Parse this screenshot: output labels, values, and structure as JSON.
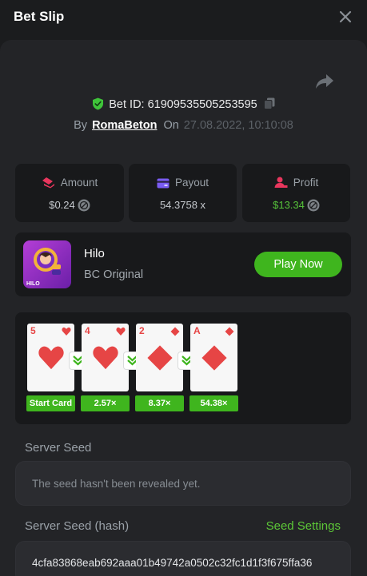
{
  "header": {
    "title": "Bet Slip"
  },
  "bet": {
    "id_text": "Bet ID: 61909535505253595",
    "by_label": "By",
    "user": "RomaBeton",
    "on_label": "On",
    "date": "27.08.2022, 10:10:08"
  },
  "stats": {
    "amount": {
      "label": "Amount",
      "value": "$0.24"
    },
    "payout": {
      "label": "Payout",
      "value": "54.3758 x"
    },
    "profit": {
      "label": "Profit",
      "value": "$13.34"
    }
  },
  "game": {
    "name": "Hilo",
    "subtitle": "BC Original",
    "play_label": "Play Now"
  },
  "cards": [
    {
      "rank": "5",
      "suit": "heart"
    },
    {
      "rank": "4",
      "suit": "heart"
    },
    {
      "rank": "2",
      "suit": "diamond"
    },
    {
      "rank": "A",
      "suit": "diamond"
    }
  ],
  "multipliers": [
    "Start Card",
    "2.57×",
    "8.37×",
    "54.38×"
  ],
  "seeds": {
    "server_label": "Server Seed",
    "server_text": "The seed hasn't been revealed yet.",
    "hash_label": "Server Seed (hash)",
    "settings_label": "Seed Settings",
    "hash_value": "4cfa83868eab692aaa01b49742a0502c32fc1d1f3f675ffa36"
  },
  "colors": {
    "accent_green": "#3fb51e",
    "profit_green": "#57c43b",
    "card_red": "#e64545"
  },
  "icons": [
    "close-icon",
    "share-icon",
    "shield-check-icon",
    "copy-icon",
    "amount-icon",
    "payout-icon",
    "profit-icon",
    "coin-icon",
    "heart-icon",
    "diamond-icon",
    "chevron-down-icon"
  ]
}
